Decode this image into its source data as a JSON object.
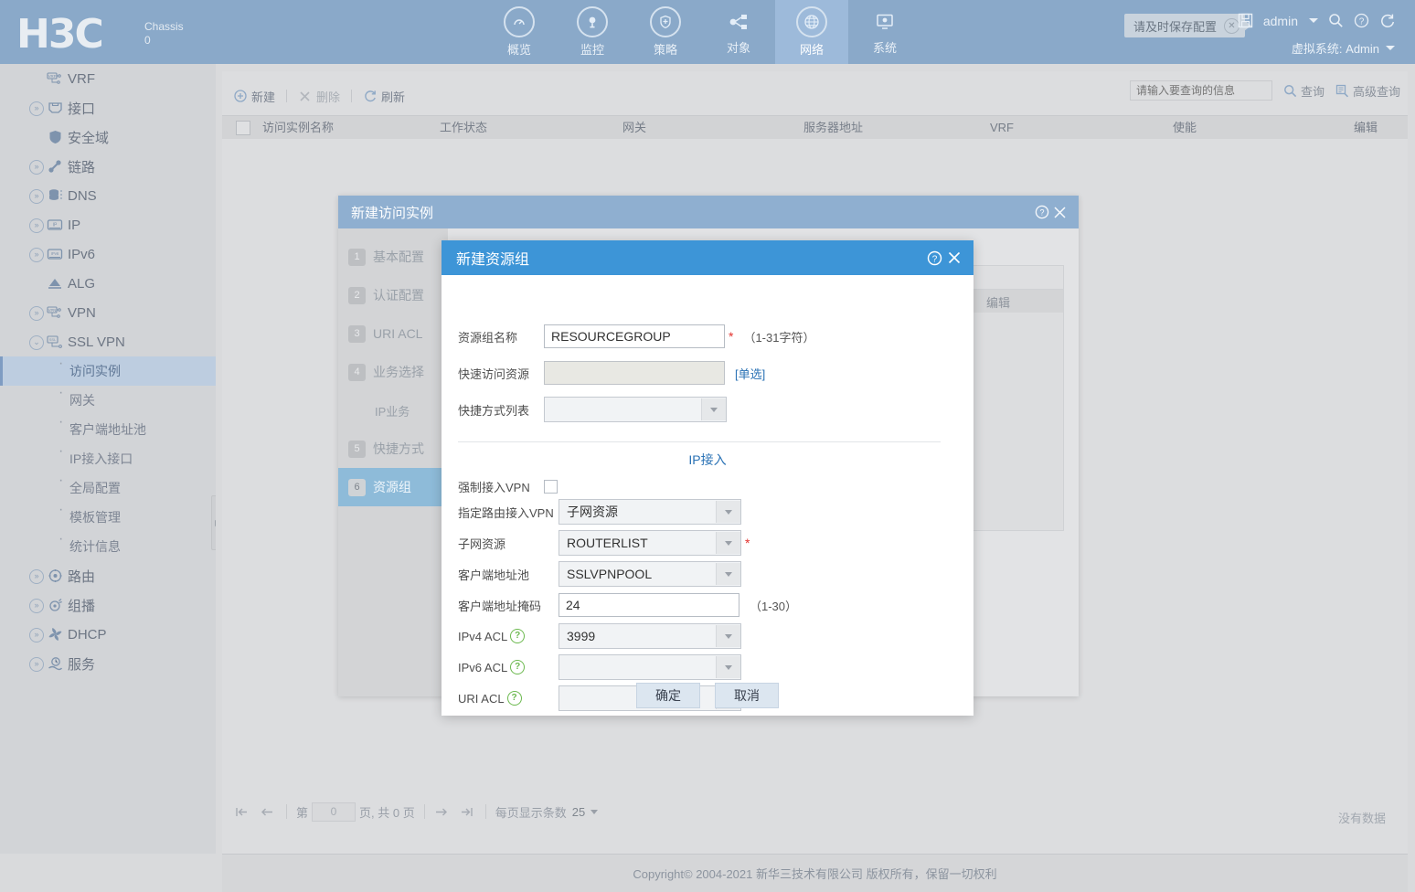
{
  "header": {
    "logo": "H3C",
    "chassis_label": "Chassis",
    "chassis_value": "0",
    "save_tip": "请及时保存配置",
    "user": "admin",
    "vsys_label": "虚拟系统: Admin",
    "nav": [
      {
        "label": "概览",
        "icon": "dashboard-icon",
        "active": false
      },
      {
        "label": "监控",
        "icon": "monitor-icon",
        "active": false
      },
      {
        "label": "策略",
        "icon": "shield-plus-icon",
        "active": false
      },
      {
        "label": "对象",
        "icon": "share-nodes-icon",
        "active": false
      },
      {
        "label": "网络",
        "icon": "globe-icon",
        "active": true
      },
      {
        "label": "系统",
        "icon": "system-gear-icon",
        "active": false
      }
    ],
    "icons": [
      "save-icon",
      "search-icon",
      "help-icon",
      "logout-icon"
    ],
    "accent": "#8aa9c9"
  },
  "sidebar": {
    "items": [
      {
        "label": "VRF",
        "icon": "vrf-icon",
        "expandable": false,
        "indent": 1
      },
      {
        "label": "接口",
        "icon": "interface-icon",
        "expandable": true,
        "indent": 0
      },
      {
        "label": "安全域",
        "icon": "security-zone-icon",
        "expandable": false,
        "indent": 1
      },
      {
        "label": "链路",
        "icon": "link-icon",
        "expandable": true,
        "indent": 0
      },
      {
        "label": "DNS",
        "icon": "dns-icon",
        "expandable": true,
        "indent": 0
      },
      {
        "label": "IP",
        "icon": "ip-icon",
        "expandable": true,
        "indent": 0
      },
      {
        "label": "IPv6",
        "icon": "ipv6-icon",
        "expandable": true,
        "indent": 0
      },
      {
        "label": "ALG",
        "icon": "alg-icon",
        "expandable": false,
        "indent": 1
      },
      {
        "label": "VPN",
        "icon": "vpn-icon",
        "expandable": true,
        "indent": 0
      },
      {
        "label": "SSL VPN",
        "icon": "ssl-vpn-icon",
        "expandable": true,
        "expanded": true,
        "indent": 0
      }
    ],
    "sslvpn_children": [
      {
        "label": "访问实例",
        "active": true
      },
      {
        "label": "网关",
        "active": false
      },
      {
        "label": "客户端地址池",
        "active": false
      },
      {
        "label": "IP接入接口",
        "active": false
      },
      {
        "label": "全局配置",
        "active": false
      },
      {
        "label": "模板管理",
        "active": false
      },
      {
        "label": "统计信息",
        "active": false
      }
    ],
    "tail_items": [
      {
        "label": "路由",
        "icon": "route-icon",
        "expandable": true
      },
      {
        "label": "组播",
        "icon": "multicast-icon",
        "expandable": true
      },
      {
        "label": "DHCP",
        "icon": "dhcp-icon",
        "expandable": true
      },
      {
        "label": "服务",
        "icon": "service-icon",
        "expandable": true
      }
    ]
  },
  "toolbar": {
    "new_label": "新建",
    "delete_label": "删除",
    "refresh_label": "刷新",
    "search_placeholder": "请输入要查询的信息",
    "search_value": "",
    "query_label": "查询",
    "adv_query_label": "高级查询"
  },
  "table": {
    "columns": [
      "访问实例名称",
      "工作状态",
      "网关",
      "服务器地址",
      "VRF",
      "使能",
      "编辑"
    ],
    "rows": [],
    "empty_text": "没有数据"
  },
  "pager": {
    "page_prefix": "第",
    "page_value": "0",
    "page_suffix": "页, 共 0 页",
    "per_page_label": "每页显示条数",
    "per_page_value": "25"
  },
  "footer": {
    "copyright": "Copyright© 2004-2021 新华三技术有限公司 版权所有，保留一切权利"
  },
  "wizard_dialog": {
    "title": "新建访问实例",
    "steps": [
      {
        "num": "1",
        "label": "基本配置",
        "active": false
      },
      {
        "num": "2",
        "label": "认证配置",
        "active": false
      },
      {
        "num": "3",
        "label": "URI ACL",
        "active": false
      },
      {
        "num": "4",
        "label": "业务选择",
        "active": false
      },
      {
        "num": "",
        "label": "IP业务",
        "active": false,
        "sub": true
      },
      {
        "num": "5",
        "label": "快捷方式",
        "active": false
      },
      {
        "num": "6",
        "label": "资源组",
        "active": true
      }
    ],
    "bg_table_col": "编辑"
  },
  "resource_dialog": {
    "title": "新建资源组",
    "fields": {
      "name_label": "资源组名称",
      "name_value": "RESOURCEGROUP",
      "name_hint": "（1-31字符）",
      "quick_res_label": "快速访问资源",
      "quick_res_value": "",
      "quick_res_link": "[单选]",
      "shortcut_list_label": "快捷方式列表",
      "shortcut_list_value": "",
      "section_title": "IP接入",
      "force_vpn_label": "强制接入VPN",
      "force_vpn_checked": false,
      "route_vpn_label": "指定路由接入VPN",
      "route_vpn_value": "子网资源",
      "subnet_res_label": "子网资源",
      "subnet_res_value": "ROUTERLIST",
      "client_pool_label": "客户端地址池",
      "client_pool_value": "SSLVPNPOOL",
      "client_mask_label": "客户端地址掩码",
      "client_mask_value": "24",
      "client_mask_hint": "（1-30）",
      "ipv4_acl_label": "IPv4 ACL",
      "ipv4_acl_value": "3999",
      "ipv6_acl_label": "IPv6 ACL",
      "ipv6_acl_value": "",
      "uri_acl_label": "URI ACL",
      "uri_acl_value": ""
    },
    "ok_label": "确定",
    "cancel_label": "取消",
    "accent": "#3d95d7"
  }
}
